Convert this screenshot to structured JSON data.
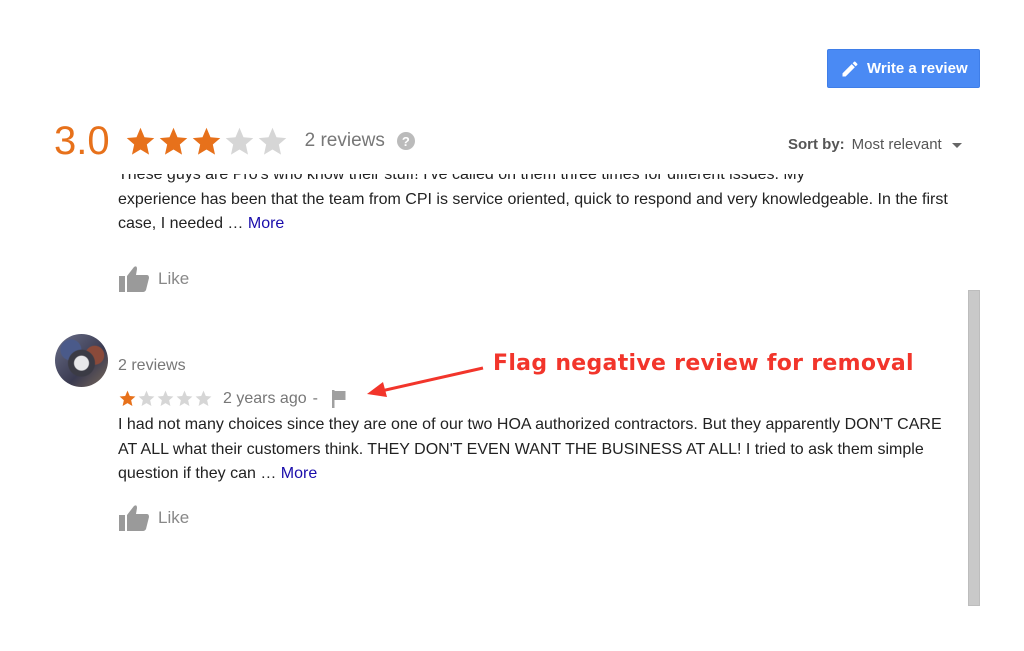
{
  "toolbar": {
    "write_review_label": "Write a review",
    "write_review_icon": "pencil-icon"
  },
  "summary": {
    "score": "3.0",
    "rating": 3,
    "max_rating": 5,
    "review_count": "2 reviews",
    "help_icon": "?"
  },
  "sort": {
    "label": "Sort by:",
    "value": "Most relevant"
  },
  "reviews": [
    {
      "text_line_clipped": "These guys are Pro's who know their stuff!  I've called on them three times for different issues.  My",
      "text": "experience has been that the team from CPI is service oriented, quick to respond and very knowledgeable.  In the first case, I needed … ",
      "more_label": "More",
      "like_label": "Like"
    },
    {
      "reviewer_review_count": "2 reviews",
      "rating": 1,
      "max_rating": 5,
      "time": "2 years ago",
      "separator": "-",
      "text": "I had not many choices since they are one of our two HOA authorized contractors. But they apparently DON'T CARE AT ALL what their customers think. THEY DON'T EVEN WANT THE BUSINESS AT ALL! I tried to ask them simple question if they can … ",
      "more_label": "More",
      "like_label": "Like"
    }
  ],
  "annotation": {
    "text": "Flag negative review for removal",
    "color": "#f2352b"
  },
  "colors": {
    "accent": "#4a8af4",
    "star_filled": "#e7711b",
    "star_empty": "#d6d6d6",
    "link": "#1a0dab"
  }
}
